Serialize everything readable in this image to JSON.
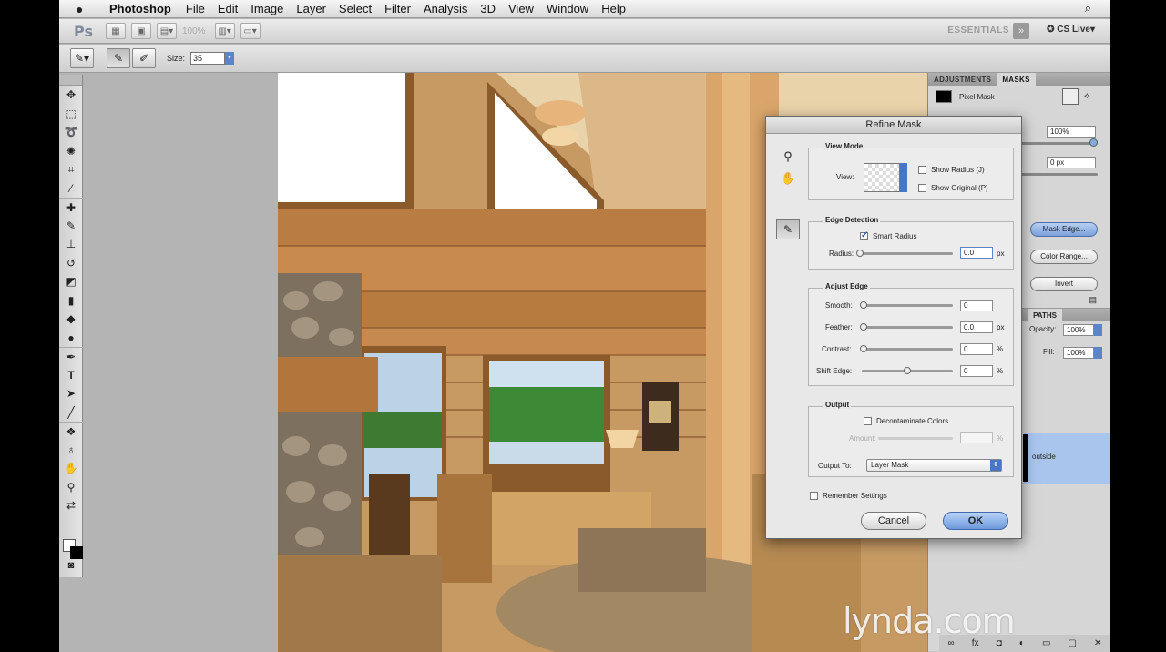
{
  "menubar": {
    "apple_icon": "apple-icon",
    "app_name": "Photoshop",
    "items": [
      "File",
      "Edit",
      "Image",
      "Layer",
      "Select",
      "Filter",
      "Analysis",
      "3D",
      "View",
      "Window",
      "Help"
    ],
    "spotlight_icon": "search-icon"
  },
  "appbar": {
    "logo": "Ps",
    "zoom": "100%",
    "workspace": "ESSENTIALS",
    "overflow": "»",
    "cs_live": "CS Live"
  },
  "options": {
    "size_label": "Size:",
    "size_value": "35"
  },
  "adjustments_panel": {
    "tabs": [
      "ADJUSTMENTS",
      "MASKS"
    ],
    "active_tab": "MASKS",
    "mask_type": "Pixel Mask",
    "density": "100%",
    "feather": "0 px",
    "buttons": [
      "Mask Edge...",
      "Color Range...",
      "Invert"
    ]
  },
  "layers_panel": {
    "tab": "PATHS",
    "opacity_label": "Opacity:",
    "opacity": "100%",
    "fill_label": "Fill:",
    "fill": "100%",
    "layer_name": "outside"
  },
  "dialog": {
    "title": "Refine Mask",
    "view_mode": {
      "label": "View Mode",
      "view_label": "View:",
      "show_radius": "Show Radius (J)",
      "show_original": "Show Original (P)"
    },
    "edge_detection": {
      "label": "Edge Detection",
      "smart_radius": "Smart Radius",
      "radius_label": "Radius:",
      "radius_value": "0.0",
      "radius_unit": "px"
    },
    "adjust_edge": {
      "label": "Adjust Edge",
      "smooth_label": "Smooth:",
      "smooth_value": "0",
      "feather_label": "Feather:",
      "feather_value": "0.0",
      "feather_unit": "px",
      "contrast_label": "Contrast:",
      "contrast_value": "0",
      "contrast_unit": "%",
      "shift_label": "Shift Edge:",
      "shift_value": "0",
      "shift_unit": "%"
    },
    "output": {
      "label": "Output",
      "decontaminate": "Decontaminate Colors",
      "amount_label": "Amount:",
      "amount_unit": "%",
      "output_to_label": "Output To:",
      "output_to": "Layer Mask"
    },
    "remember": "Remember Settings",
    "cancel": "Cancel",
    "ok": "OK"
  },
  "watermark": "lynda.com"
}
